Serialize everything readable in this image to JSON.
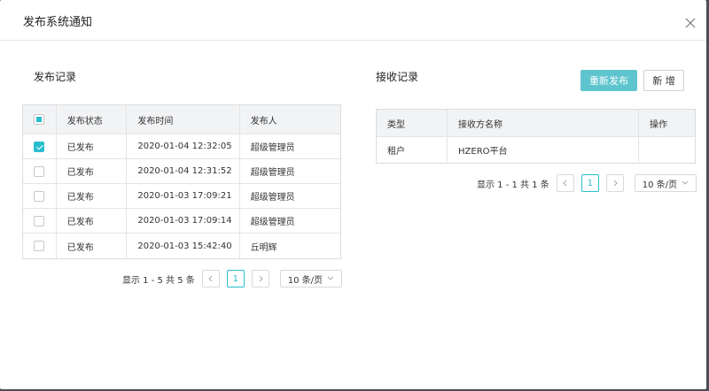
{
  "modal": {
    "title": "发布系统通知"
  },
  "left": {
    "title": "发布记录",
    "columns": [
      "发布状态",
      "发布时间",
      "发布人"
    ],
    "rows": [
      {
        "status": "已发布",
        "time": "2020-01-04 12:32:05",
        "publisher": "超级管理员",
        "checked": true
      },
      {
        "status": "已发布",
        "time": "2020-01-04 12:31:52",
        "publisher": "超级管理员",
        "checked": false
      },
      {
        "status": "已发布",
        "time": "2020-01-03 17:09:21",
        "publisher": "超级管理员",
        "checked": false
      },
      {
        "status": "已发布",
        "time": "2020-01-03 17:09:14",
        "publisher": "超级管理员",
        "checked": false
      },
      {
        "status": "已发布",
        "time": "2020-01-03 15:42:40",
        "publisher": "丘明辉",
        "checked": false
      }
    ],
    "pager": {
      "summary": "显示 1 - 5 共 5 条",
      "page": "1",
      "size": "10 条/页"
    }
  },
  "right": {
    "title": "接收记录",
    "republish_label": "重新发布",
    "add_label": "新 增",
    "columns": [
      "类型",
      "接收方名称",
      "操作"
    ],
    "rows": [
      {
        "type": "租户",
        "name": "HZERO平台",
        "action": ""
      }
    ],
    "pager": {
      "summary": "显示 1 - 1 共 1 条",
      "page": "1",
      "size": "10 条/页"
    }
  },
  "icons": {
    "close": "close-icon",
    "prev": "chevron-left-icon",
    "next": "chevron-right-icon",
    "dropdown": "chevron-down-icon"
  },
  "colors": {
    "accent": "#29bece",
    "primary_button": "#5ec5cf",
    "table_header": "#f2f3f5"
  }
}
